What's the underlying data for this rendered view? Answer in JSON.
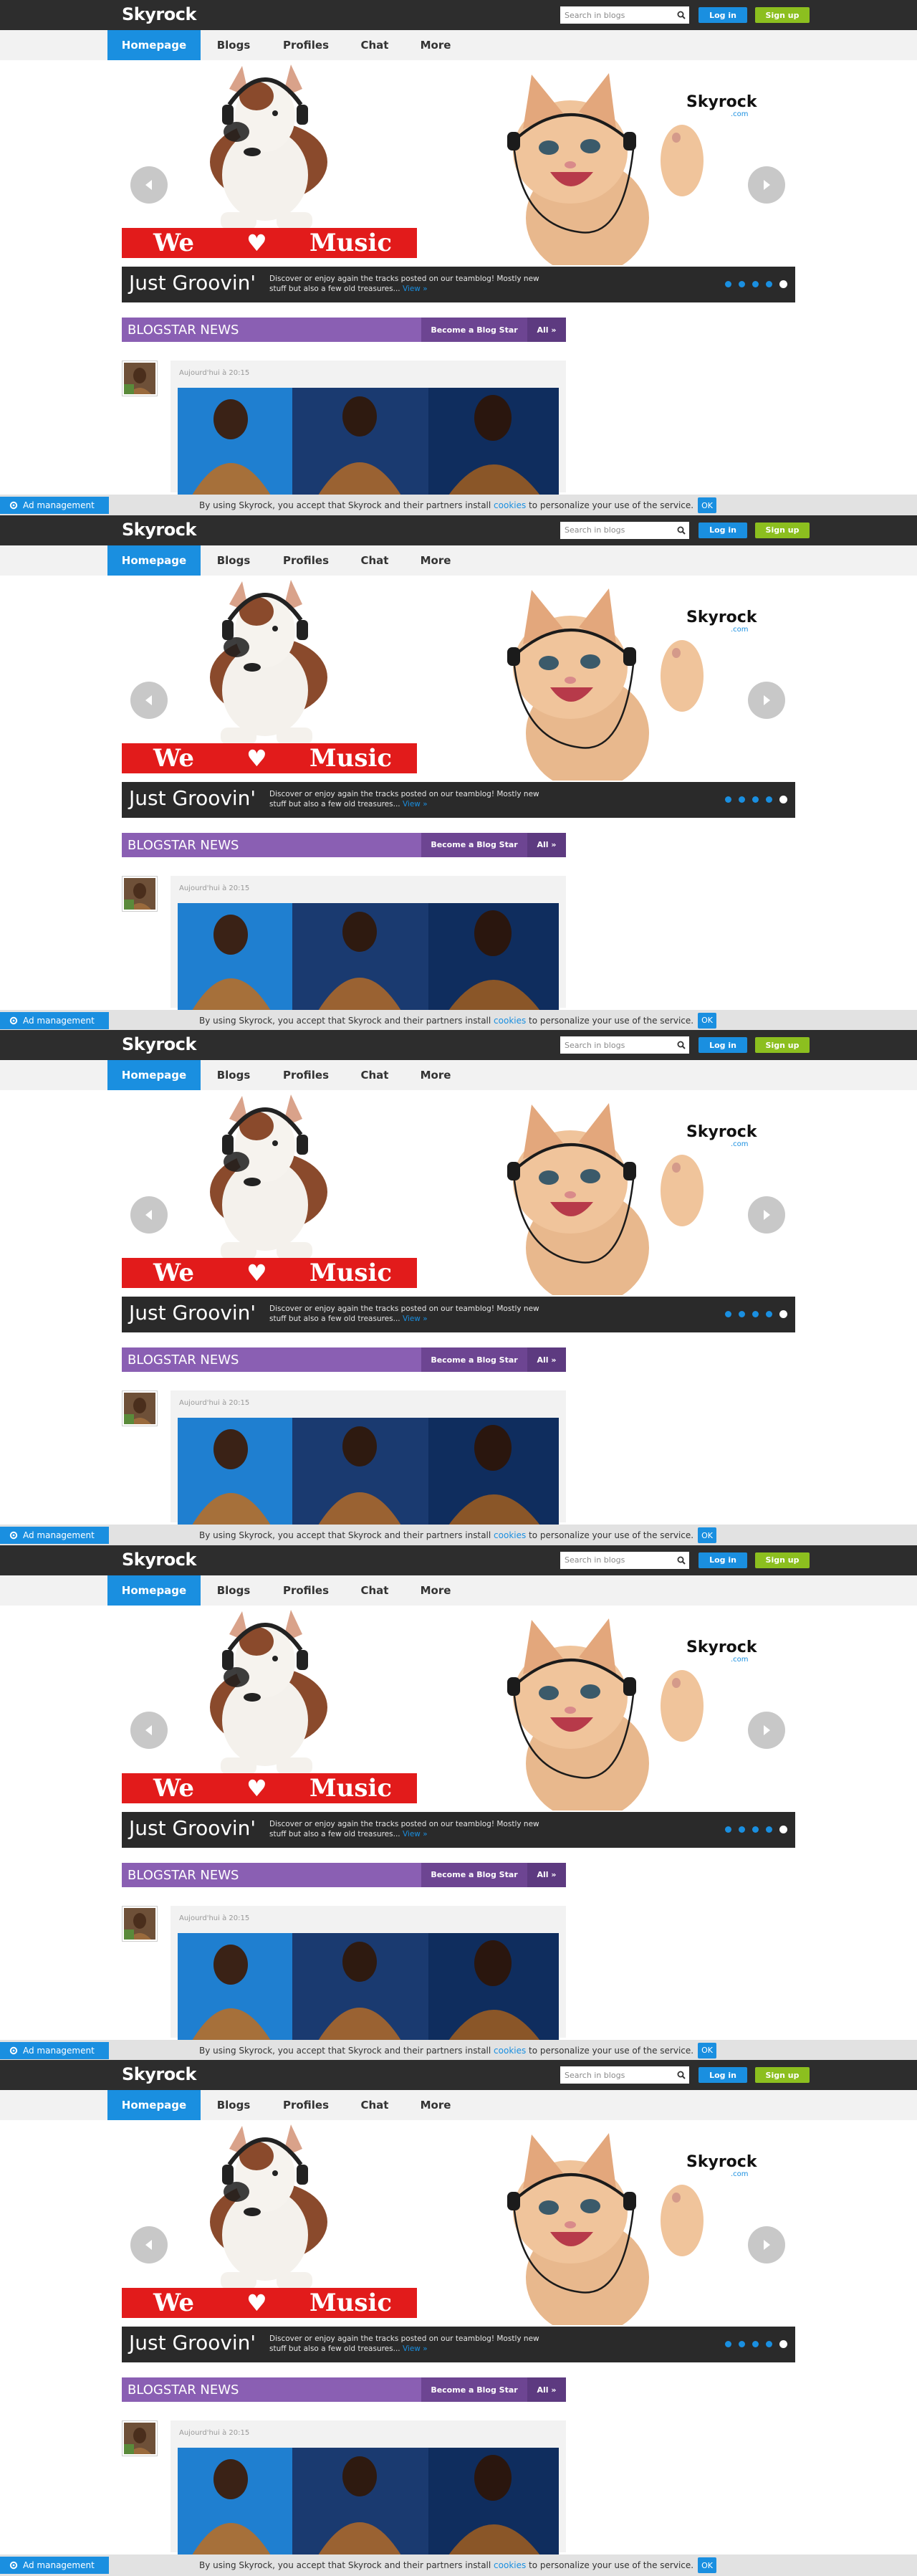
{
  "header": {
    "logo": "Skyrock",
    "search_placeholder": "Search in blogs",
    "login_label": "Log in",
    "signup_label": "Sign up"
  },
  "nav": {
    "items": [
      {
        "label": "Homepage",
        "active": true
      },
      {
        "label": "Blogs"
      },
      {
        "label": "Profiles"
      },
      {
        "label": "Chat"
      },
      {
        "label": "More"
      }
    ]
  },
  "hero": {
    "banner_left": "We",
    "banner_heart": "♥",
    "banner_right": "Music",
    "badge_brand": "Skyrock",
    "badge_suffix": ".com",
    "title": "Just Groovin'",
    "description": "Discover or enjoy again the tracks posted on our teamblog! Mostly new stuff but also a few old treasures...",
    "view_label": "View »",
    "slide_count": 5,
    "active_slide": 5
  },
  "blogstar": {
    "title": "BLOGSTAR NEWS",
    "become_label": "Become a Blog Star",
    "all_label": "All »",
    "post_time": "Aujourd'hui à 20:15"
  },
  "cookie": {
    "ad_label": "Ad management",
    "text_before": "By using Skyrock, you accept that Skyrock and their partners install ",
    "link": "cookies",
    "text_after": " to personalize your use of the service.",
    "ok_label": "OK"
  },
  "colors": {
    "accent_blue": "#1a8fe0",
    "signup_green": "#8cbf1f",
    "banner_red": "#e21b1b",
    "blogstar_purple": "#8a5fb3"
  }
}
